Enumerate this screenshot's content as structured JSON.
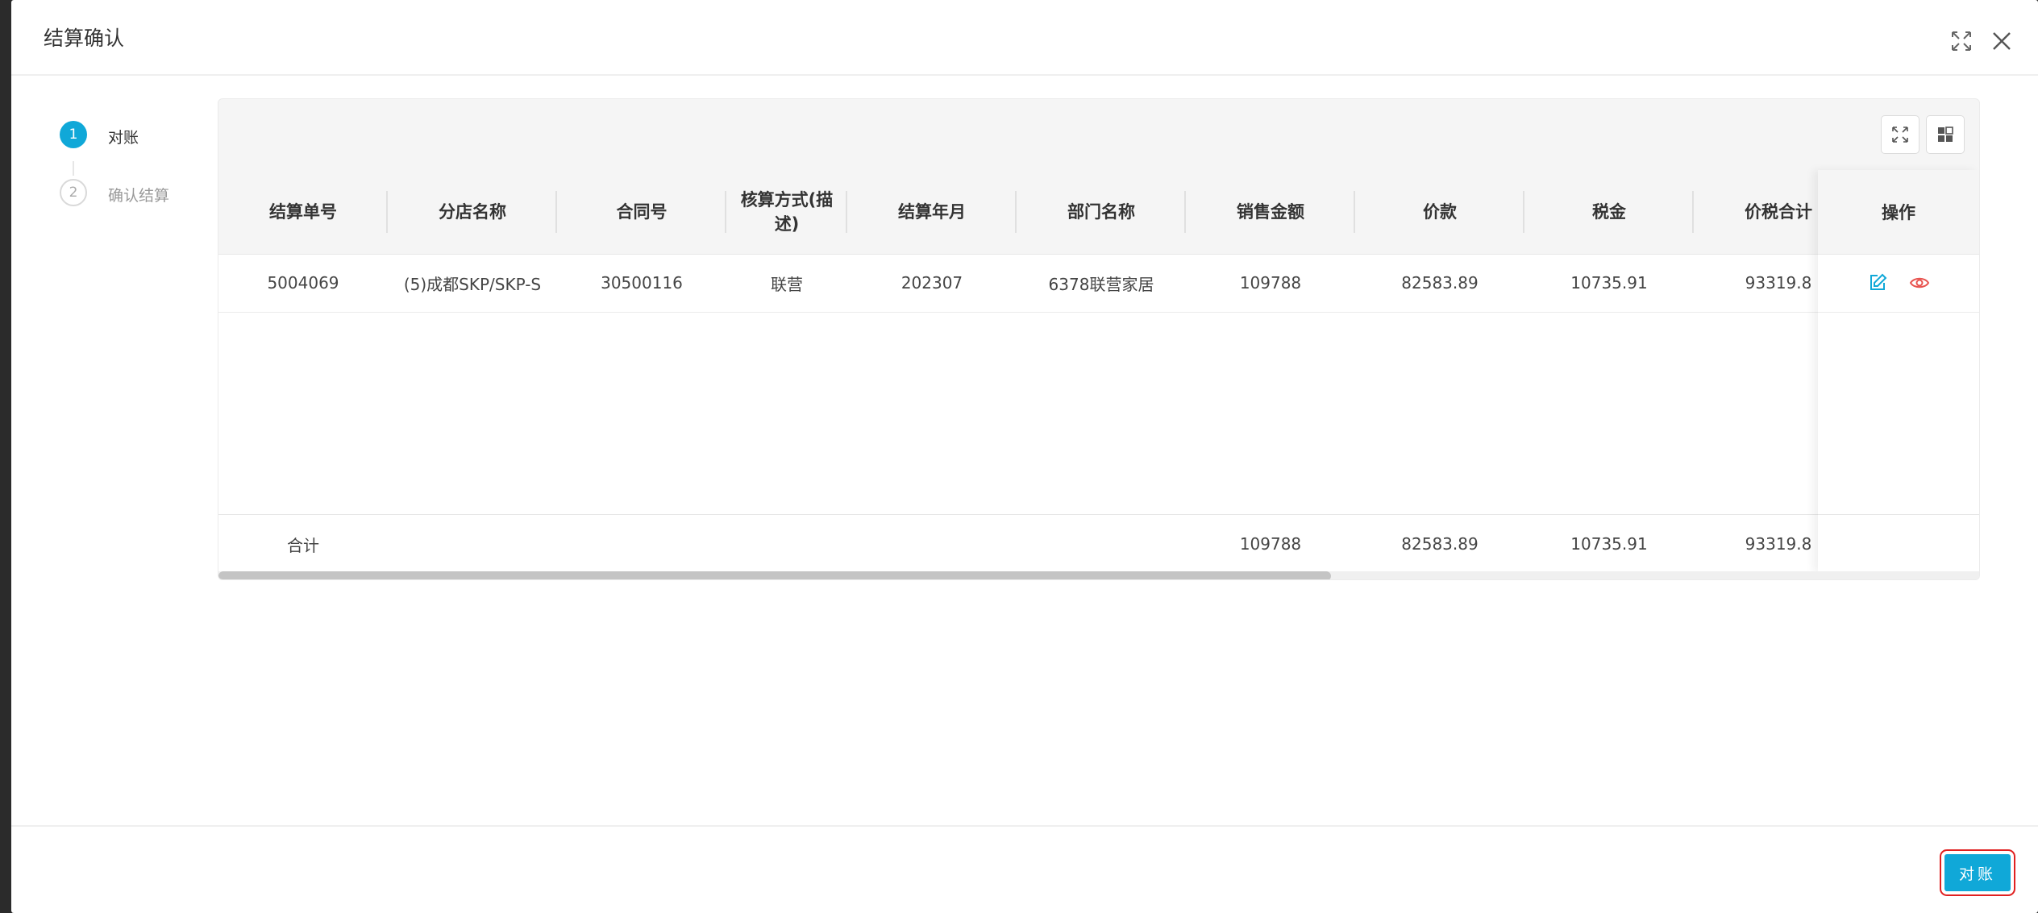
{
  "modal": {
    "title": "结算确认"
  },
  "steps": [
    {
      "number": "1",
      "label": "对账",
      "state": "active"
    },
    {
      "number": "2",
      "label": "确认结算",
      "state": "inactive"
    }
  ],
  "table": {
    "columns": [
      "结算单号",
      "分店名称",
      "合同号",
      "核算方式(描述)",
      "结算年月",
      "部门名称",
      "销售金额",
      "价款",
      "税金",
      "价税合计"
    ],
    "action_column": "操作",
    "rows": [
      [
        "5004069",
        "(5)成都SKP/SKP-S",
        "30500116",
        "联营",
        "202307",
        "6378联营家居",
        "109788",
        "82583.89",
        "10735.91",
        "93319.8"
      ]
    ],
    "footer": {
      "label": "合计",
      "sales_amount": "109788",
      "price": "82583.89",
      "tax": "10735.91",
      "total": "93319.8"
    }
  },
  "footer": {
    "confirm_label": "对账"
  },
  "colors": {
    "primary": "#10a8d8",
    "highlight_border": "#e02020",
    "view_icon": "#e8534f"
  },
  "icons": [
    "fullscreen-icon",
    "close-icon",
    "expand-icon",
    "grid-icon",
    "edit-icon",
    "view-icon"
  ]
}
